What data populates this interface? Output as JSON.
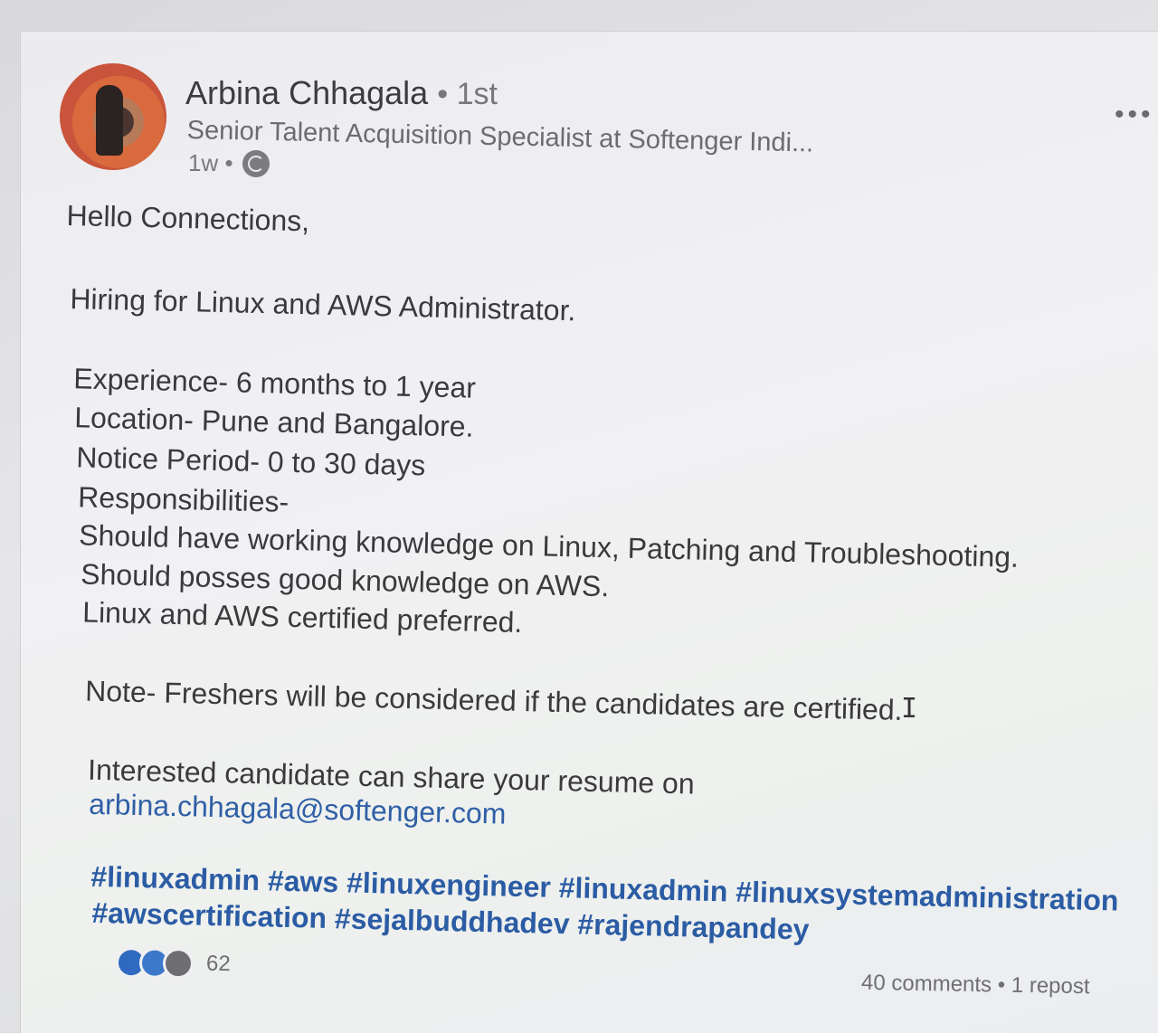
{
  "post": {
    "author": {
      "name": "Arbina Chhagala",
      "degree": "• 1st",
      "headline": "Senior Talent Acquisition Specialist at Softenger Indi...",
      "time": "1w •"
    },
    "more_label": "•••",
    "lines": [
      "Hello Connections,",
      "Hiring for Linux and AWS Administrator.",
      "Experience- 6 months to 1 year",
      "Location- Pune and Bangalore.",
      "Notice Period- 0 to 30 days",
      "Responsibilities-",
      "Should have working knowledge on Linux, Patching and Troubleshooting.",
      "Should posses good knowledge on AWS.",
      "Linux and AWS certified preferred.",
      "Note- Freshers will be considered if the candidates are certified.",
      "Interested candidate can share your resume on"
    ],
    "email": "arbina.chhagala@softenger.com",
    "hashtags_line1": "#linuxadmin #aws #linuxengineer #linuxadmin #linuxsystemadministration",
    "hashtags_line2": "#awscertification #sejalbuddhadev #rajendrapandey",
    "reactions_count": "62",
    "comments": "40 comments",
    "separator": "•",
    "reposts": "1 repost"
  },
  "colors": {
    "link": "#2f5fa6",
    "hashtag": "#2b5ca4",
    "reaction_blue": "#2f6ac0"
  },
  "icons": {
    "globe": "globe-icon",
    "more": "more-options-icon",
    "cursor": "text-cursor-icon"
  }
}
